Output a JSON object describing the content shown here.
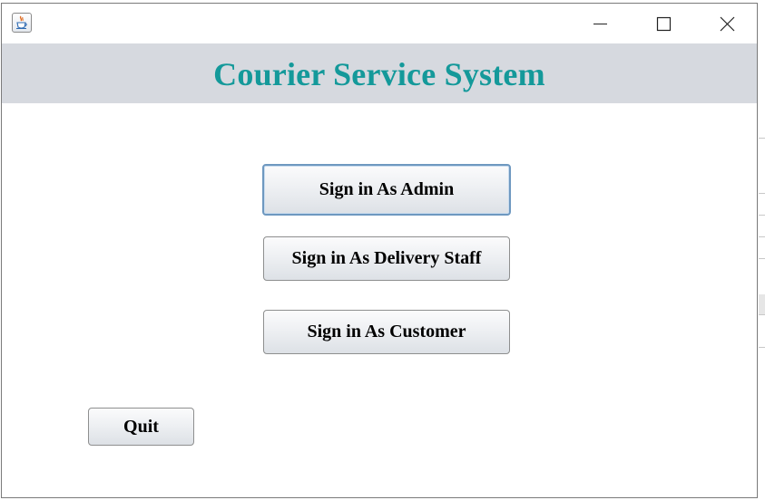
{
  "window": {
    "app_icon": "java-coffee-cup-icon",
    "controls": {
      "minimize_icon": "minimize-icon",
      "maximize_icon": "maximize-icon",
      "close_icon": "close-icon"
    }
  },
  "header": {
    "title": "Courier Service System"
  },
  "buttons": {
    "admin_label": "Sign in As Admin",
    "staff_label": "Sign in As Delivery Staff",
    "customer_label": "Sign in As Customer",
    "quit_label": "Quit"
  },
  "colors": {
    "title_color": "#14999a",
    "header_background": "#d6d9df",
    "focus_border": "#6e98c0"
  }
}
